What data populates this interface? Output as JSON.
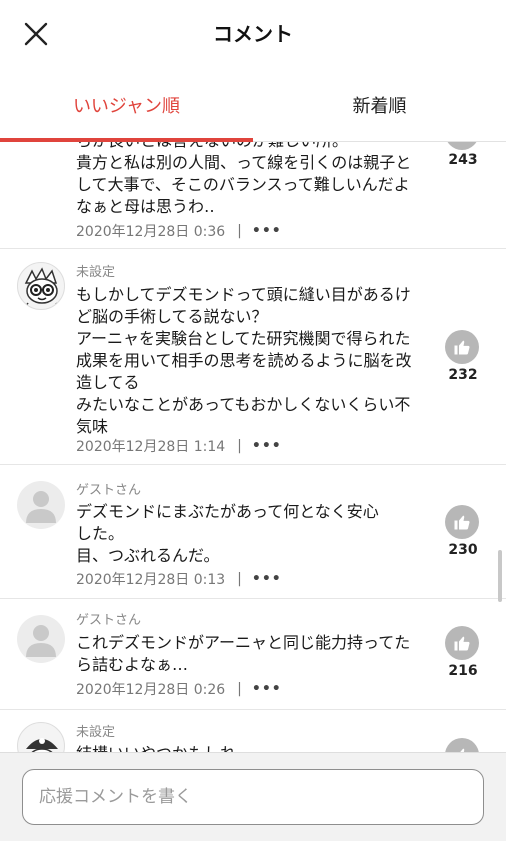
{
  "header": {
    "title": "コメント",
    "close_icon": "close-icon"
  },
  "tabs": [
    {
      "label": "いいジャン順",
      "active": true
    },
    {
      "label": "新着順",
      "active": false
    }
  ],
  "comments": [
    {
      "author": "",
      "avatar": "none",
      "lines": [
        "ちか良いとは言えないのか難しい所。",
        "貴方と私は別の人間、って線を引くのは親子と",
        "して大事で、そこのバランスって難しいんだよ",
        "なぁと母は思うわ‥"
      ],
      "date": "2020年12月28日 0:36",
      "separator": "|",
      "more": "•••",
      "likes": "243"
    },
    {
      "author": "未設定",
      "avatar": "character-illustration",
      "lines": [
        "もしかしてデズモンドって頭に縫い目があるけ",
        "ど脳の手術してる説ない？",
        "アーニャを実験台としてた研究機関で得られた",
        "成果を用いて相手の思考を読めるように脳を改",
        "造してる",
        "みたいなことがあってもおかしくないくらい不",
        "気味"
      ],
      "date": "2020年12月28日 1:14",
      "separator": "|",
      "more": "•••",
      "likes": "232"
    },
    {
      "author": "ゲストさん",
      "avatar": "default-user",
      "lines": [
        "デズモンドにまぶたがあって何となく安心",
        "した。",
        "目、つぶれるんだ。"
      ],
      "date": "2020年12月28日 0:13",
      "separator": "|",
      "more": "•••",
      "likes": "230"
    },
    {
      "author": "ゲストさん",
      "avatar": "default-user",
      "lines": [
        "これデズモンドがアーニャと同じ能力持ってた",
        "ら詰むよなぁ…"
      ],
      "date": "2020年12月28日 0:26",
      "separator": "|",
      "more": "•••",
      "likes": "216"
    },
    {
      "author": "未設定",
      "avatar": "pirate-illustration",
      "lines": [
        "結構いいやつかもしれ"
      ],
      "date": "",
      "separator": "",
      "more": "",
      "likes": ""
    }
  ],
  "footer": {
    "input_placeholder": "応援コメントを書く",
    "input_value": ""
  },
  "colors": {
    "accent": "#e0443c",
    "like_button": "#b7b7b7",
    "footer_bg": "#f2f2f2"
  }
}
